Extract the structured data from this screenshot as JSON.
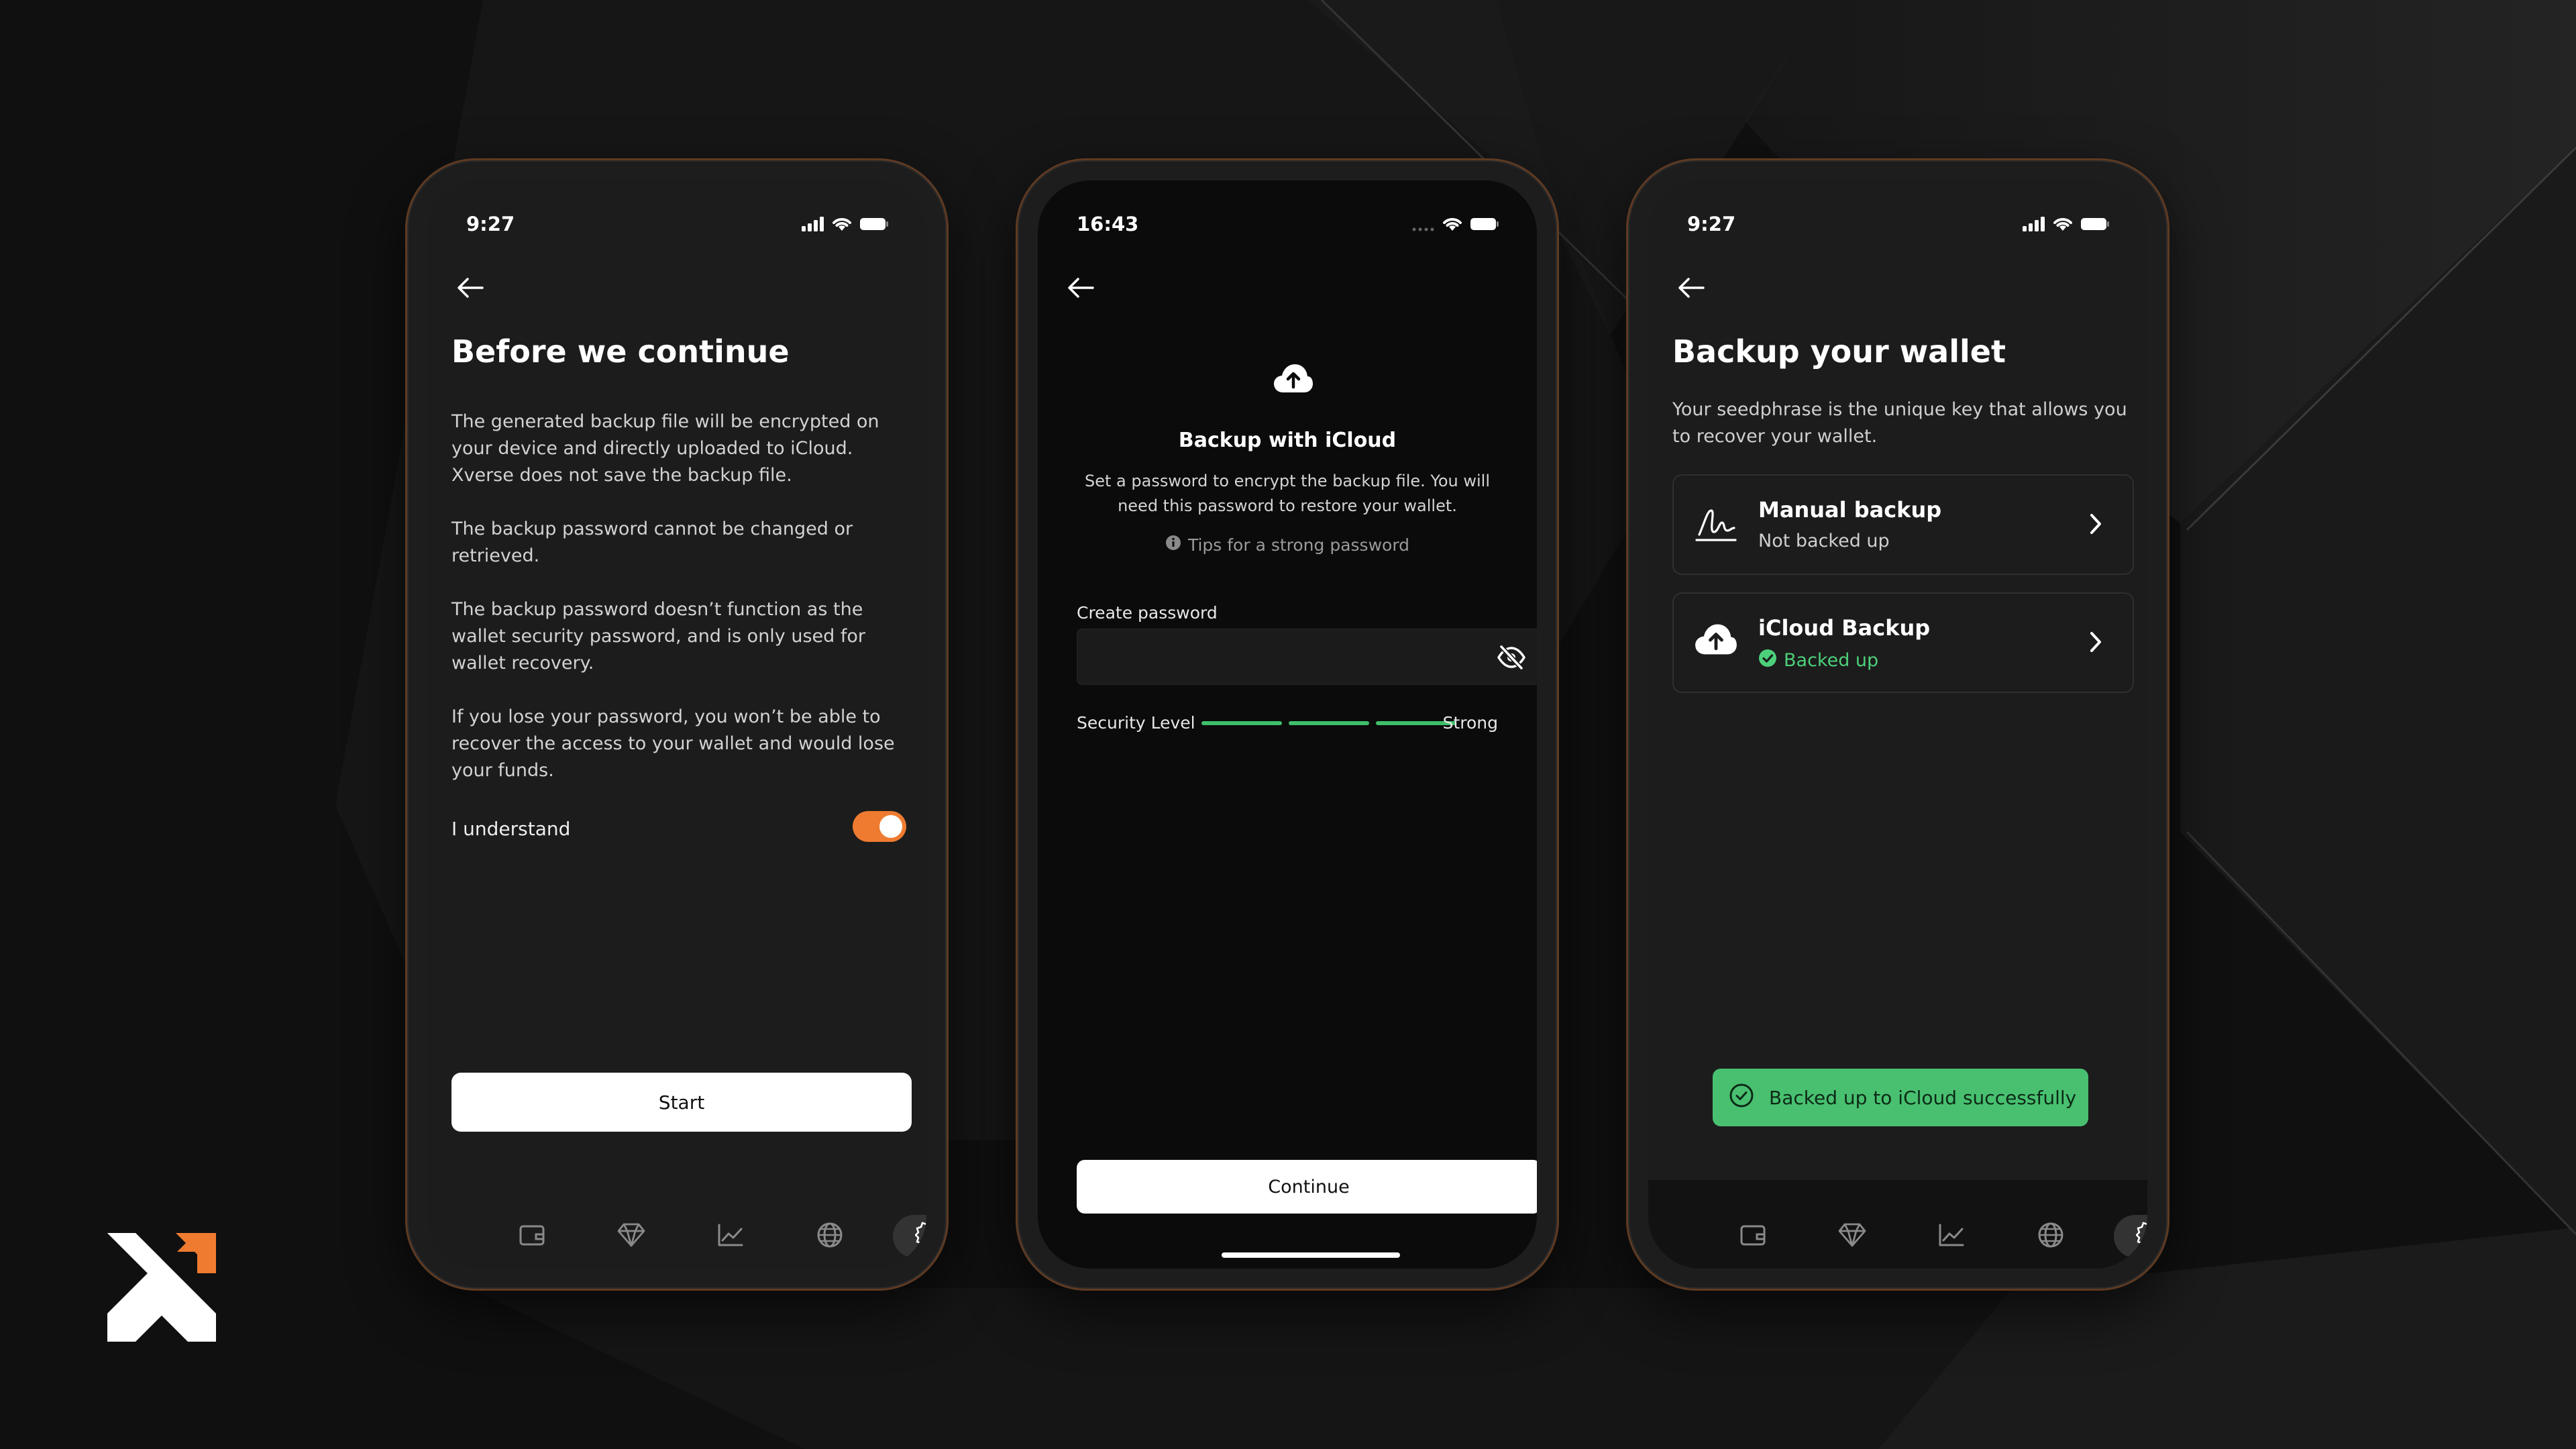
{
  "colors": {
    "accent": "#ee7b30",
    "success": "#48c070",
    "background": "#101010"
  },
  "brand": {
    "logo_icon": "xverse-logo-icon"
  },
  "screen1": {
    "time": "9:27",
    "title": "Before we continue",
    "paragraphs": [
      "The generated backup file will be encrypted on your device and directly uploaded to iCloud. Xverse does not save the backup file.",
      "The backup password cannot be changed or retrieved.",
      "The backup password doesn’t function as the wallet security password, and is only used for wallet recovery.",
      "If you lose your password, you won’t be able to recover the access to your wallet and would lose your funds."
    ],
    "understand_label": "I understand",
    "understand_checked": true,
    "start_label": "Start"
  },
  "screen2": {
    "time": "16:43",
    "title": "Backup with iCloud",
    "description": "Set a password to encrypt the backup file. You will need this password to restore your wallet.",
    "tips_label": "Tips for a strong password",
    "password_label": "Create password",
    "password_value": "",
    "security_label": "Security Level",
    "security_strength": "Strong",
    "security_bars_filled": 3,
    "continue_label": "Continue"
  },
  "screen3": {
    "time": "9:27",
    "title": "Backup your wallet",
    "description": "Your seedphrase is the unique key that allows you to recover your wallet.",
    "options": [
      {
        "title": "Manual backup",
        "status": "Not backed up",
        "icon": "signature-icon"
      },
      {
        "title": "iCloud Backup",
        "status": "Backed up",
        "icon": "cloud-upload-icon"
      }
    ],
    "toast": "Backed up to iCloud successfully"
  },
  "tabbar": {
    "tabs": [
      "wallet-icon",
      "diamond-icon",
      "chart-icon",
      "globe-icon",
      "settings-icon"
    ],
    "active": "settings-icon"
  }
}
